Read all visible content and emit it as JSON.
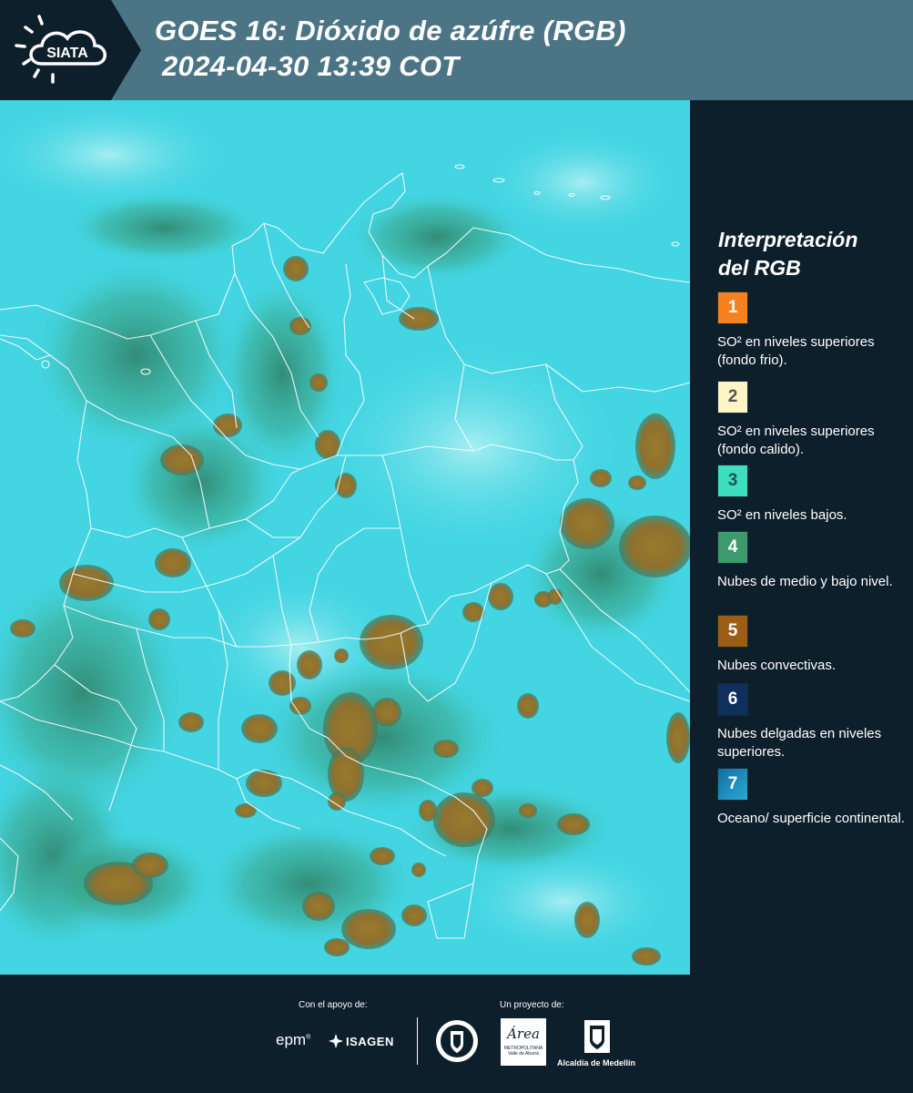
{
  "header": {
    "logo_text": "SIATA",
    "title_line1": "GOES 16: Dióxido de azúfre (RGB)",
    "title_line2": "2024-04-30 13:39 COT"
  },
  "legend": {
    "title_line1": "Interpretación",
    "title_line2": "del RGB",
    "items": [
      {
        "number": "1",
        "color": "#f6821f",
        "label": "SO² en niveles superiores (fondo frio)."
      },
      {
        "number": "2",
        "color": "#fdf5c4",
        "label": "SO² en niveles superiores (fondo calido)."
      },
      {
        "number": "3",
        "color": "#3ddfc0",
        "label": "SO² en niveles bajos."
      },
      {
        "number": "4",
        "color": "#3d9a6c",
        "label": "Nubes de medio y bajo nivel."
      },
      {
        "number": "5",
        "color": "#9c5e17",
        "label": "Nubes convectivas."
      },
      {
        "number": "6",
        "color": "#0f2f5c",
        "label": "Nubes delgadas en niveles superiores."
      },
      {
        "number": "7",
        "color": "#1c8fbf",
        "label": "Oceano/ superficie continental."
      }
    ]
  },
  "footer": {
    "support_label": "Con el apoyo de:",
    "project_label": "Un proyecto de:",
    "sponsor_epm": "epm",
    "sponsor_isagen": "ISAGEN",
    "area_name": "Área",
    "area_sub1": "METROPOLITANA",
    "area_sub2": "Valle de Aburrá",
    "alcaldia": "Alcaldía de Medellín"
  },
  "colors": {
    "header_bg": "#4b7485",
    "panel_bg": "#0e1f2c",
    "surface_cyan": "#41d6e3",
    "convective_brown": "#9a7a2c"
  }
}
